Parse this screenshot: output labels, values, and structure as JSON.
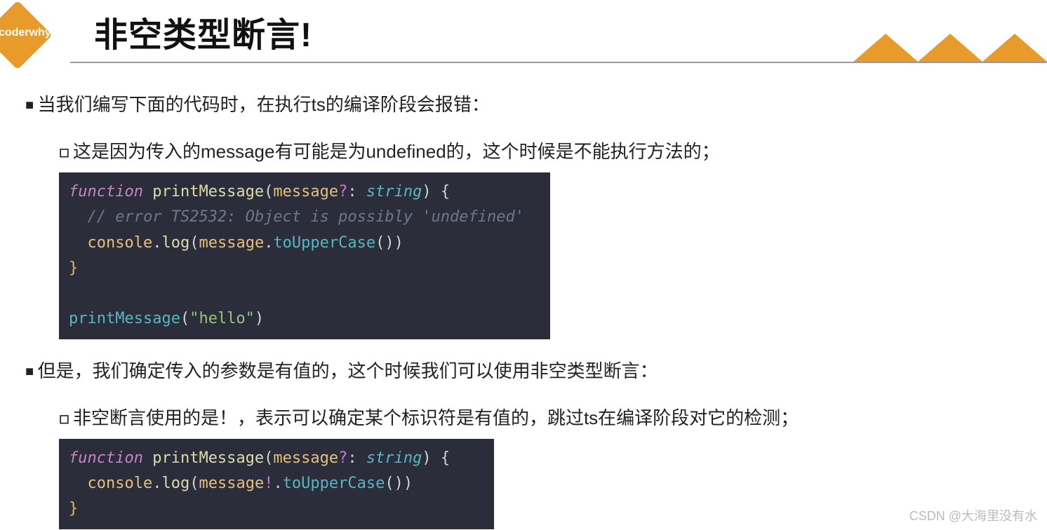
{
  "logo_text": "coderwhy",
  "title": "非空类型断言!",
  "bullets": {
    "b1": "当我们编写下面的代码时，在执行ts的编译阶段会报错：",
    "b1_1": "这是因为传入的message有可能是为undefined的，这个时候是不能执行方法的；",
    "b2": "但是，我们确定传入的参数是有值的，这个时候我们可以使用非空类型断言：",
    "b2_1": "非空断言使用的是！，表示可以确定某个标识符是有值的，跳过ts在编译阶段对它的检测；"
  },
  "code1": {
    "l1_kw": "function",
    "l1_fn": "printMessage",
    "l1_param": "message",
    "l1_opt": "?",
    "l1_colon": ": ",
    "l1_type": "string",
    "l1_brace": ") {",
    "l2_comment": "// error TS2532: Object is possibly 'undefined'",
    "l3_obj": "console",
    "l3_dot1": ".",
    "l3_log": "log",
    "l3_open": "(",
    "l3_msg": "message",
    "l3_dot2": ".",
    "l3_upper": "toUpperCase",
    "l3_close": "())",
    "l4_brace": "}",
    "l6_fn": "printMessage",
    "l6_open": "(",
    "l6_str": "\"hello\"",
    "l6_close": ")"
  },
  "code2": {
    "l1_kw": "function",
    "l1_fn": "printMessage",
    "l1_param": "message",
    "l1_opt": "?",
    "l1_colon": ": ",
    "l1_type": "string",
    "l1_brace": ") {",
    "l2_obj": "console",
    "l2_dot1": ".",
    "l2_log": "log",
    "l2_open": "(",
    "l2_msg": "message",
    "l2_bang": "!",
    "l2_dot2": ".",
    "l2_upper": "toUpperCase",
    "l2_close": "())",
    "l3_brace": "}"
  },
  "watermark": "CSDN @大海里没有水"
}
